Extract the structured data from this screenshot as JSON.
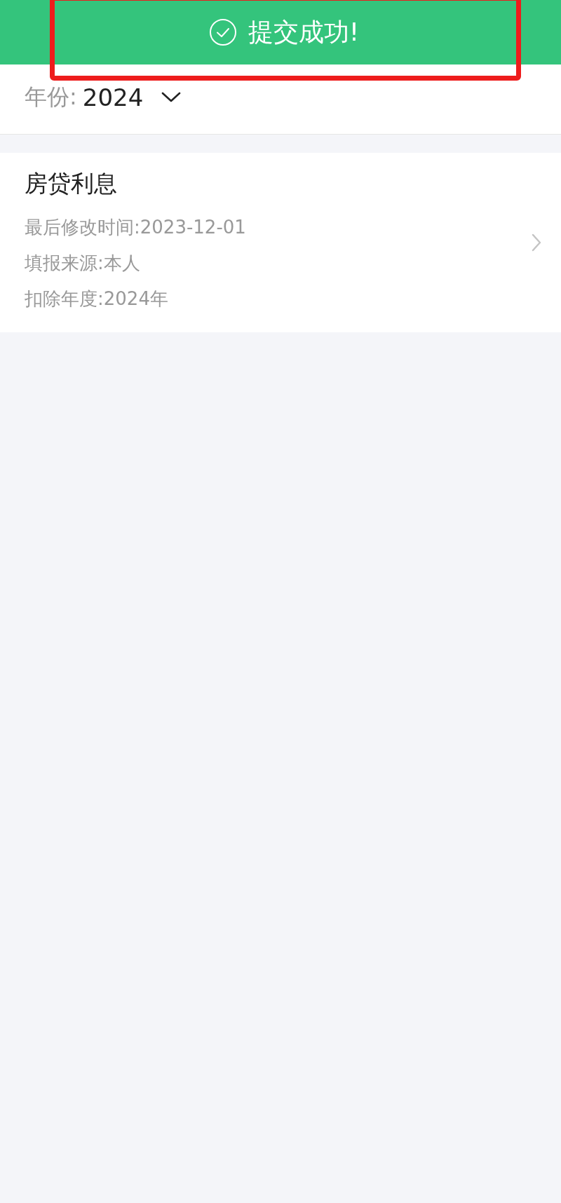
{
  "toast": {
    "kind": "success",
    "text": "提交成功!"
  },
  "year_filter": {
    "label": "年份:",
    "value": "2024"
  },
  "records": [
    {
      "title": "房贷利息",
      "fields": [
        "最后修改时间:2023-12-01",
        "填报来源:本人",
        "扣除年度:2024年"
      ]
    }
  ]
}
